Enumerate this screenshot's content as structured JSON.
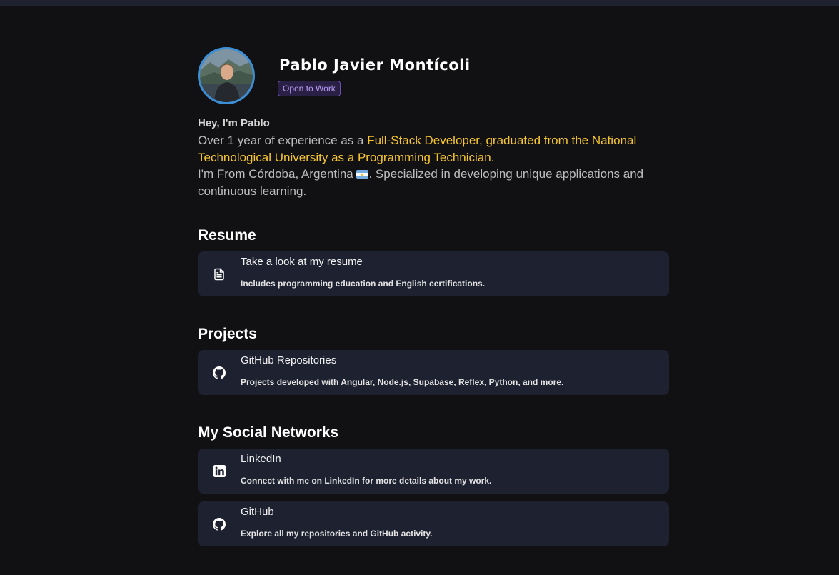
{
  "profile": {
    "name": "Pablo Javier Montícoli",
    "badge": "Open to Work"
  },
  "intro": {
    "greeting": "Hey, I'm Pablo",
    "bio_part1": "Over 1 year of experience as a ",
    "bio_highlight": "Full-Stack Developer, graduated from the National Technological University as a Programming Technician.",
    "bio_part2": "I'm From Córdoba, Argentina ",
    "bio_part3": ". Specialized in developing unique applications and continuous learning."
  },
  "sections": {
    "resume": {
      "title": "Resume",
      "card_title": "Take a look at my resume",
      "card_desc": "Includes programming education and English certifications.",
      "icon": "document-icon"
    },
    "projects": {
      "title": "Projects",
      "card_title": "GitHub Repositories",
      "card_desc": "Projects developed with Angular, Node.js, Supabase, Reflex, Python, and more.",
      "icon": "github-icon"
    },
    "social": {
      "title": "My Social Networks",
      "linkedin_title": "LinkedIn",
      "linkedin_desc": "Connect with me on LinkedIn for more details about my work.",
      "linkedin_icon": "linkedin-icon",
      "github_title": "GitHub",
      "github_desc": "Explore all my repositories and GitHub activity.",
      "github_icon": "github-icon"
    }
  },
  "colors": {
    "background": "#111114",
    "card": "#1e2130",
    "highlight": "#f6c531",
    "badge_text": "#b89cf5",
    "avatar_border": "#3b8fd6"
  }
}
